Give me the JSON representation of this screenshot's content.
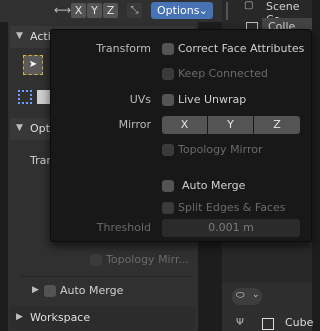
{
  "header": {
    "axes": [
      "X",
      "Y",
      "Z"
    ],
    "options_label": "Options"
  },
  "outliner": {
    "title": "Scene Co",
    "collection_label": "Colle",
    "cube_label": "Cube"
  },
  "sidebar": {
    "active_tool_label": "Acti",
    "options_label": "Opti",
    "transform_label": "Tran",
    "topology_mirror_label": "Topology Mirr...",
    "auto_merge_label": "Auto Merge",
    "workspace_label": "Workspace"
  },
  "popup": {
    "transform": {
      "label": "Transform",
      "correct_face": "Correct Face Attributes",
      "keep_connected": "Keep Connected"
    },
    "uvs": {
      "label": "UVs",
      "live_unwrap": "Live Unwrap"
    },
    "mirror": {
      "label": "Mirror",
      "x": "X",
      "y": "Y",
      "z": "Z",
      "topology_mirror": "Topology Mirror"
    },
    "auto_merge": "Auto Merge",
    "split_edges": "Split Edges & Faces",
    "threshold": {
      "label": "Threshold",
      "value": "0.001 m"
    }
  }
}
